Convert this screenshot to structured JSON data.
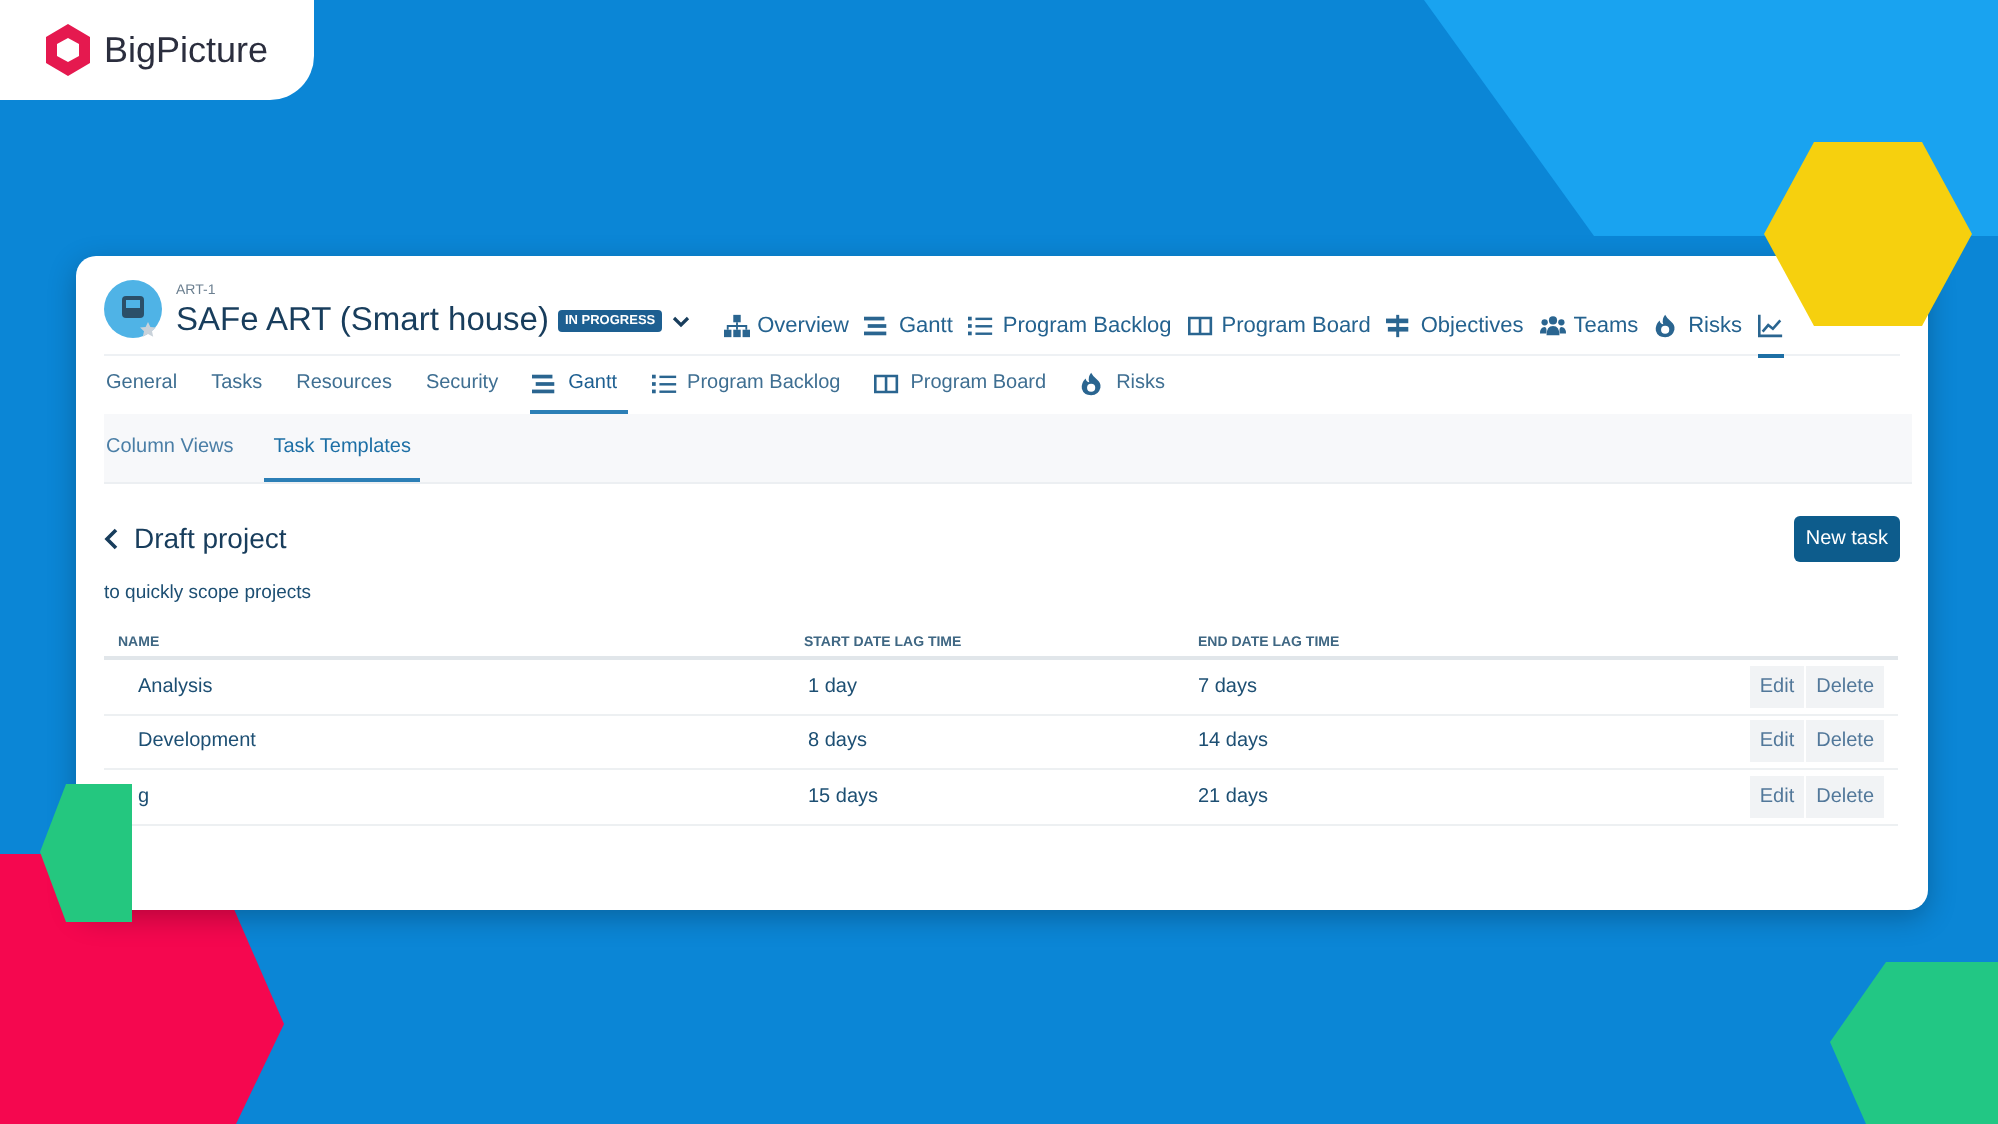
{
  "logo": {
    "text": "BigPicture"
  },
  "header": {
    "key": "ART-1",
    "title": "SAFe ART (Smart house)",
    "status": "IN PROGRESS"
  },
  "top_nav": [
    {
      "kind": "hierarchy",
      "label": "Overview",
      "selected": false
    },
    {
      "kind": "gantt",
      "label": "Gantt",
      "selected": false
    },
    {
      "kind": "list",
      "label": "Program Backlog",
      "selected": false
    },
    {
      "kind": "board",
      "label": "Program Board",
      "selected": false
    },
    {
      "kind": "objectives",
      "label": "Objectives",
      "selected": false
    },
    {
      "kind": "teams",
      "label": "Teams",
      "selected": false
    },
    {
      "kind": "risk",
      "label": "Risks",
      "selected": false
    },
    {
      "kind": "chart",
      "selected": true
    }
  ],
  "tabs": [
    {
      "label": "General",
      "selected": false
    },
    {
      "label": "Tasks",
      "selected": false
    },
    {
      "label": "Resources",
      "selected": false
    },
    {
      "label": "Security",
      "selected": false
    },
    {
      "kind": "gantt",
      "label": "Gantt",
      "selected": true
    },
    {
      "kind": "list",
      "label": "Program Backlog",
      "selected": false
    },
    {
      "kind": "board",
      "label": "Program Board",
      "selected": false
    },
    {
      "kind": "risk",
      "label": "Risks",
      "selected": false
    }
  ],
  "subtabs": [
    {
      "label": "Column Views",
      "selected": false
    },
    {
      "label": "Task Templates",
      "selected": true
    }
  ],
  "page": {
    "title": "Draft project",
    "description": "to quickly scope projects",
    "button": "New task"
  },
  "table": {
    "columns": [
      "NAME",
      "START DATE LAG TIME",
      "END DATE LAG TIME"
    ],
    "rows": [
      {
        "name": "Analysis",
        "start": "1 day",
        "end": "7 days",
        "actions": [
          "Edit",
          "Delete"
        ]
      },
      {
        "name": "Development",
        "start": "8 days",
        "end": "14 days",
        "actions": [
          "Edit",
          "Delete"
        ]
      },
      {
        "name": "g",
        "start": "15 days",
        "end": "21 days",
        "actions": [
          "Edit",
          "Delete"
        ]
      }
    ]
  }
}
